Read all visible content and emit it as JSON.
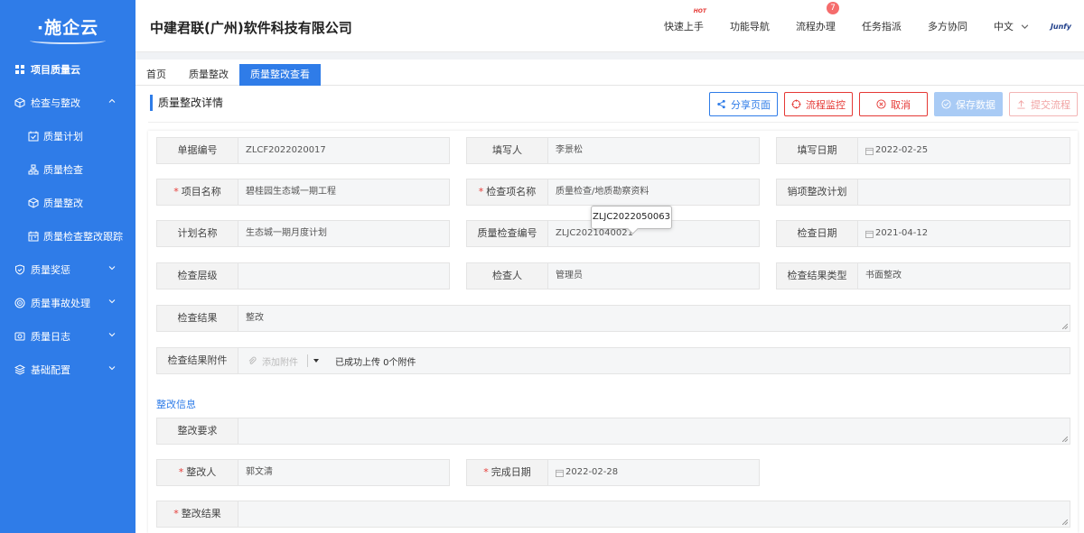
{
  "app": {
    "logo": "·施企云",
    "company": "中建君联(广州)软件科技有限公司"
  },
  "header": {
    "nav": [
      {
        "label": "快速上手",
        "hot": "HOT"
      },
      {
        "label": "功能导航"
      },
      {
        "label": "流程办理",
        "badge": "7"
      },
      {
        "label": "任务指派"
      },
      {
        "label": "多方协同"
      }
    ],
    "language": "中文",
    "brand": "Junfy"
  },
  "sidebar": {
    "items": [
      {
        "label": "项目质量云",
        "icon": "grid-icon"
      },
      {
        "label": "检查与整改",
        "icon": "cube-icon",
        "expanded": true
      },
      {
        "label": "质量计划",
        "icon": "calendar-check-icon"
      },
      {
        "label": "质量检查",
        "icon": "org-chart-icon"
      },
      {
        "label": "质量整改",
        "icon": "cube-icon"
      },
      {
        "label": "质量检查整改跟踪",
        "icon": "calendar-icon"
      },
      {
        "label": "质量奖惩",
        "icon": "shield-icon"
      },
      {
        "label": "质量事故处理",
        "icon": "target-icon"
      },
      {
        "label": "质量日志",
        "icon": "log-icon"
      },
      {
        "label": "基础配置",
        "icon": "layers-icon"
      }
    ]
  },
  "tabs": [
    {
      "label": "首页"
    },
    {
      "label": "质量整改"
    },
    {
      "label": "质量整改查看",
      "active": true
    }
  ],
  "panel": {
    "title": "质量整改详情",
    "buttons": {
      "share": "分享页面",
      "monitor": "流程监控",
      "cancel": "取消",
      "save": "保存数据",
      "submit": "提交流程"
    }
  },
  "form": {
    "doc_no": {
      "label": "单据编号",
      "value": "ZLCF2022020017"
    },
    "filler": {
      "label": "填写人",
      "value": "李景松"
    },
    "fill_date": {
      "label": "填写日期",
      "value": "2022-02-25"
    },
    "project": {
      "label": "项目名称",
      "value": "碧桂园生态城一期工程"
    },
    "check_item": {
      "label": "检查项名称",
      "value": "质量检查/地质勘察资料"
    },
    "close_plan": {
      "label": "销项整改计划",
      "value": ""
    },
    "plan_name": {
      "label": "计划名称",
      "value": "生态城一期月度计划"
    },
    "check_no": {
      "label": "质量检查编号",
      "value": "ZLJC2021040021"
    },
    "check_date": {
      "label": "检查日期",
      "value": "2021-04-12"
    },
    "check_level": {
      "label": "检查层级",
      "value": ""
    },
    "inspector": {
      "label": "检查人",
      "value": "管理员"
    },
    "result_type": {
      "label": "检查结果类型",
      "value": "书面整改"
    },
    "result": {
      "label": "检查结果",
      "value": "整改"
    },
    "attachment": {
      "label": "检查结果附件",
      "add": "添加附件",
      "status": "已成功上传 0个附件"
    },
    "tooltip": "ZLJC2022050063",
    "section": "整改信息",
    "requirement": {
      "label": "整改要求",
      "value": ""
    },
    "rectifier": {
      "label": "整改人",
      "value": "郭文清"
    },
    "finish_date": {
      "label": "完成日期",
      "value": "2022-02-28"
    },
    "rect_result": {
      "label": "整改结果",
      "value": ""
    }
  }
}
